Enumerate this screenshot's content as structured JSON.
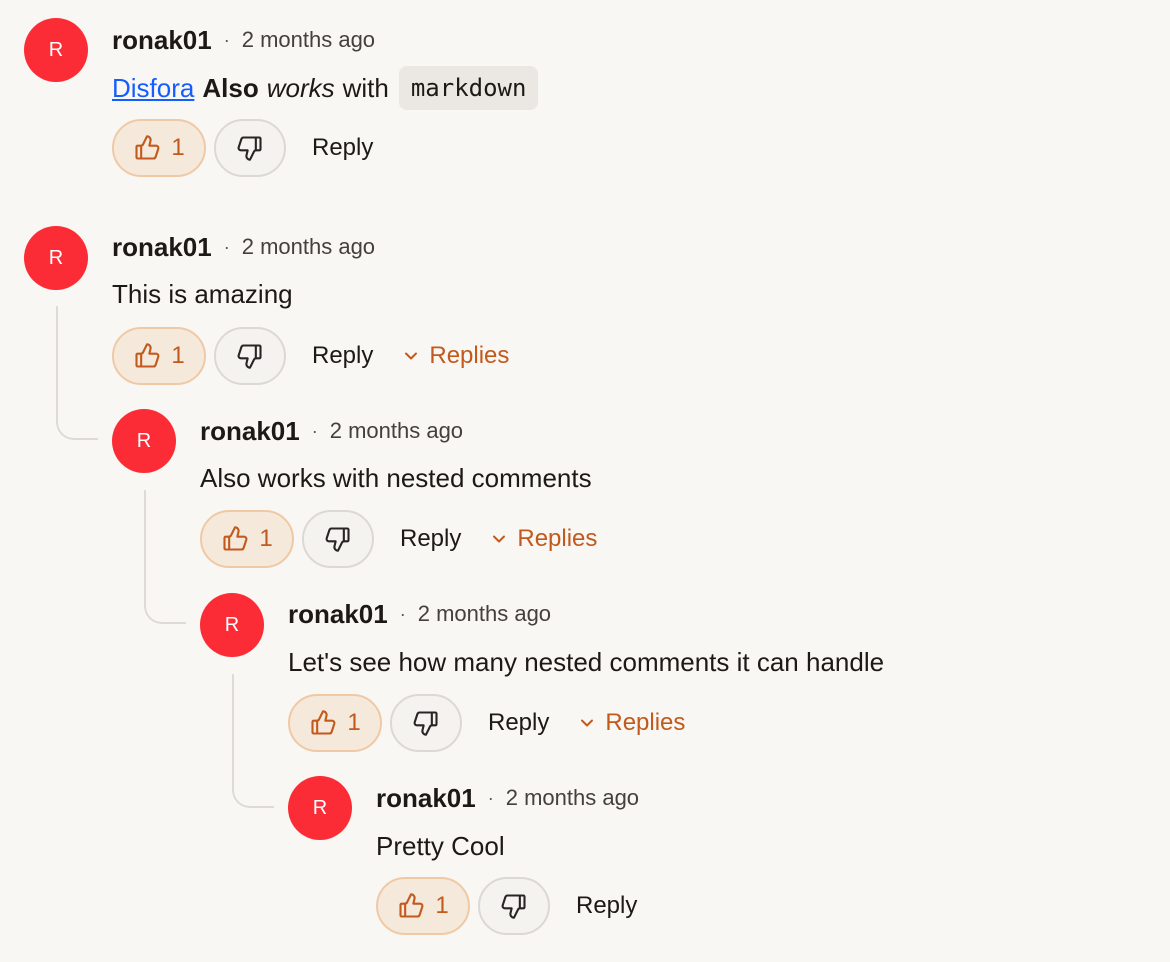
{
  "comments": [
    {
      "avatar_letter": "R",
      "username": "ronak01",
      "separator": "·",
      "time": "2 months ago",
      "body": {
        "link": "Disfora",
        "bold": "Also",
        "italic": "works",
        "text": "with",
        "code": "markdown"
      },
      "likes": "1",
      "reply_label": "Reply"
    },
    {
      "avatar_letter": "R",
      "username": "ronak01",
      "separator": "·",
      "time": "2 months ago",
      "text": "This is amazing",
      "likes": "1",
      "reply_label": "Reply",
      "replies_label": "Replies"
    },
    {
      "avatar_letter": "R",
      "username": "ronak01",
      "separator": "·",
      "time": "2 months ago",
      "text": "Also works with nested comments",
      "likes": "1",
      "reply_label": "Reply",
      "replies_label": "Replies"
    },
    {
      "avatar_letter": "R",
      "username": "ronak01",
      "separator": "·",
      "time": "2 months ago",
      "text": "Let's see how many nested comments it can handle",
      "likes": "1",
      "reply_label": "Reply",
      "replies_label": "Replies"
    },
    {
      "avatar_letter": "R",
      "username": "ronak01",
      "separator": "·",
      "time": "2 months ago",
      "text": "Pretty Cool",
      "likes": "1",
      "reply_label": "Reply"
    }
  ],
  "icons": {
    "like": "thumbs-up-icon",
    "dislike": "thumbs-down-icon",
    "expand": "chevron-down-icon"
  },
  "colors": {
    "background": "#f9f7f3",
    "avatar": "#fb2c36",
    "accent": "#c2591d",
    "link": "#155dfc"
  }
}
